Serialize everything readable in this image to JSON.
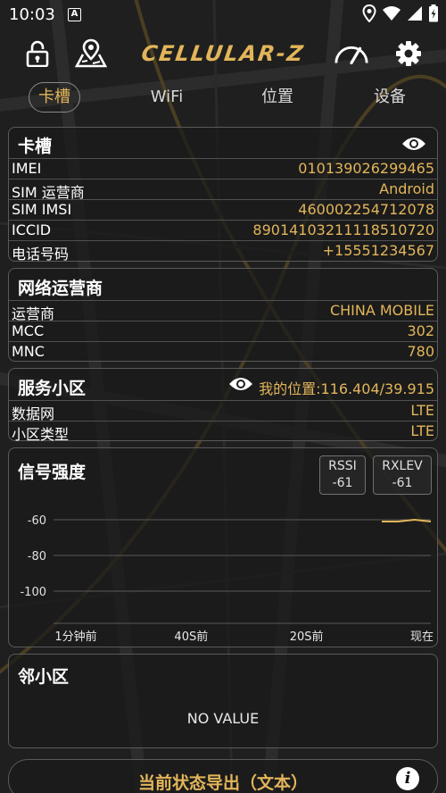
{
  "status": {
    "time": "10:03",
    "app_badge": "A"
  },
  "app": {
    "logo": "CELLULAR-Z"
  },
  "tabs": [
    {
      "label": "卡槽"
    },
    {
      "label": "WiFi"
    },
    {
      "label": "位置"
    },
    {
      "label": "设备"
    }
  ],
  "sim_card": {
    "title": "卡槽",
    "rows": [
      {
        "key": "IMEI",
        "value": "010139026299465"
      },
      {
        "key": "SIM 运营商",
        "value": "Android"
      },
      {
        "key": "SIM IMSI",
        "value": "460002254712078"
      },
      {
        "key": "ICCID",
        "value": "89014103211118510720"
      },
      {
        "key": "电话号码",
        "value": "+15551234567"
      }
    ]
  },
  "network_card": {
    "title": "网络运营商",
    "rows": [
      {
        "key": "运营商",
        "value": "CHINA MOBILE"
      },
      {
        "key": "MCC",
        "value": "302"
      },
      {
        "key": "MNC",
        "value": "780"
      }
    ]
  },
  "cell_card": {
    "title": "服务小区",
    "location": "我的位置:116.404/39.915",
    "rows": [
      {
        "key": "数据网",
        "value": "LTE"
      },
      {
        "key": "小区类型",
        "value": "LTE"
      }
    ]
  },
  "signal_card": {
    "title": "信号强度",
    "rssi": {
      "label": "RSSI",
      "value": "-61"
    },
    "rxlev": {
      "label": "RXLEV",
      "value": "-61"
    }
  },
  "chart_data": {
    "type": "line",
    "title": "信号强度",
    "x": [
      "1分钟前",
      "40S前",
      "20S前",
      "现在"
    ],
    "yticks": [
      -60,
      -80,
      -100
    ],
    "ylim": [
      -118,
      -40
    ],
    "series": [
      {
        "values": [
          -61,
          -61,
          -60,
          -61
        ]
      }
    ],
    "grid": true,
    "colors": {
      "line": "#e2b55a",
      "grid": "#5a5a5a"
    }
  },
  "neighbor_card": {
    "title": "邻小区",
    "empty_text": "NO VALUE"
  },
  "export": {
    "label": "当前状态导出（文本）",
    "info": "i"
  },
  "colors": {
    "accent": "#e2b55a",
    "background": "#1c1c1c",
    "border": "#5a5a5a"
  },
  "icons": [
    "lock-icon",
    "map-pin-icon",
    "speedometer-icon",
    "gear-icon",
    "eye-icon",
    "info-icon",
    "location-icon",
    "wifi-icon",
    "signal-icon",
    "battery-icon"
  ]
}
